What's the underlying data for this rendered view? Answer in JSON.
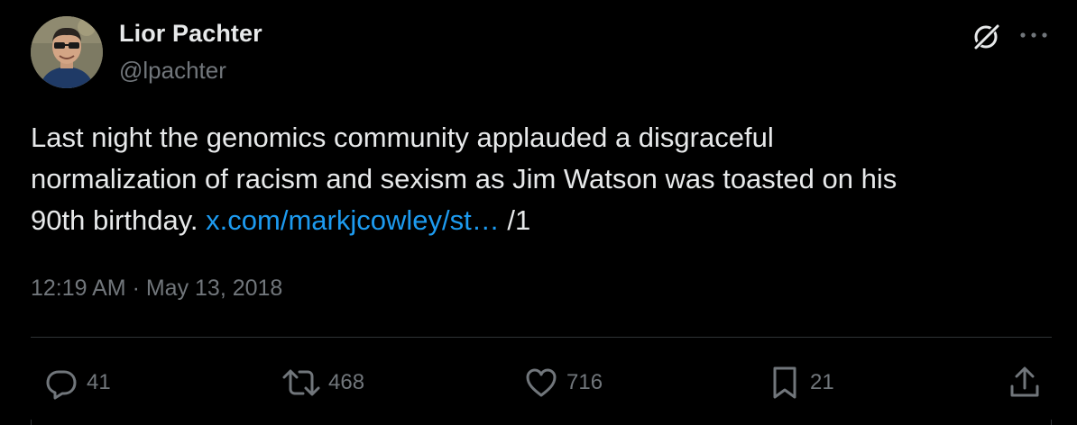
{
  "author": {
    "name": "Lior Pachter",
    "handle": "@lpachter",
    "avatar_icon": "profile-photo"
  },
  "header_icons": {
    "grok": "grok-icon",
    "more": "more-icon"
  },
  "tweet": {
    "text_line1": "Last night the genomics community applauded a disgraceful",
    "text_line2": "normalization of racism and sexism as Jim Watson was toasted on his",
    "text_line3_prefix": "90th birthday. ",
    "link": "x.com/markjcowley/st…",
    "text_line3_suffix": " /1",
    "timestamp": "12:19 AM · May 13, 2018"
  },
  "actions": {
    "replies": "41",
    "retweets": "468",
    "likes": "716",
    "bookmarks": "21"
  },
  "colors": {
    "background": "#000000",
    "text": "#e7e9ea",
    "secondary": "#71767b",
    "link": "#1d9bf0",
    "divider": "#2f3336"
  }
}
